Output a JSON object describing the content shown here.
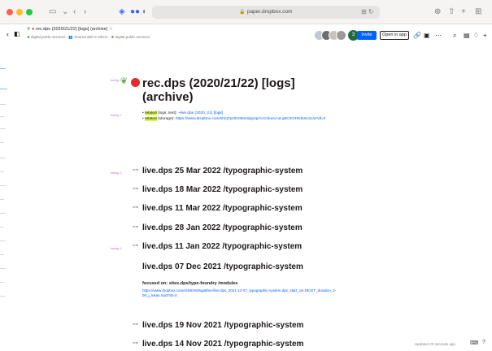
{
  "browser": {
    "url": "paper.dropbox.com",
    "back_icon": "chevron-left-icon",
    "forward_icon": "chevron-right-icon"
  },
  "paper": {
    "title": "rec.dps (2020/21/22) [logs] (archive)",
    "title_star": "☆",
    "breadcrumb": "digital.public.services",
    "shared": "Shared with 6 others",
    "shared_tag": "digital.public.services",
    "avatar_count": "3",
    "invite_label": "Invite",
    "open_label": "Open in app"
  },
  "doc": {
    "labels": {
      "title": "turnhg: 1",
      "bullets": "turnhg: 1",
      "entry1": "turnhg: 1",
      "entry5": "turnhg: 1"
    },
    "title_line1": "rec.dps (2020/21/22) [logs]",
    "title_line2": "(archive)",
    "bullet1_tag": "related",
    "bullet1_text": " (logs, text): ",
    "bullet1_link": "~live.dps (2020_21) [logs]",
    "bullet2_tag": "related",
    "bullet2_text": " (storage): ",
    "bullet2_link": "https://www.dropbox.com/sh/q7pz0m95mstpysp/AACduvU-uLq6C2O4RdneU1Ua?dl=0",
    "entries": [
      "live.dps 25 Mar 2022 /typographic-system",
      "live.dps 18 Mar 2022 /typographic-system",
      "live.dps 11 Mar 2022 /typographic-system",
      "live.dps 28 Jan 2022 /typographic-system",
      "live.dps 11 Jan 2022 /typographic-system",
      "live.dps 07 Dec 2021 /typographic-system",
      "live.dps 19 Nov 2021 /typographic-system",
      "live.dps 14 Nov 2021 /typographic-system"
    ],
    "focused_on": "focused on: sites.dps/type-foundry /modules",
    "focused_link": "https://www.dropbox.com/s/45tz9xf6gatthez/live.dps_2021-12-07_typographic-system.dps_start_16-19CET_duration_2-00_j_lukas.mp3?dl=0"
  },
  "status": {
    "updated": "Updated 20 seconds ago"
  },
  "colors": {
    "accent": "#0061fe",
    "highlight": "#d7f54a",
    "label": "#c569b9"
  }
}
